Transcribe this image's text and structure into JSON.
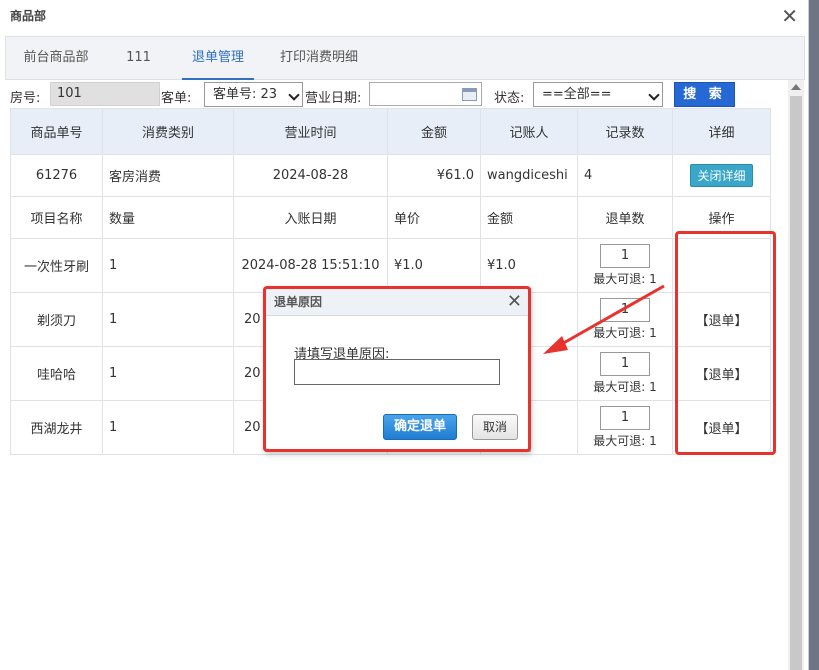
{
  "window": {
    "title": "商品部"
  },
  "tabs": [
    {
      "label": "前台商品部"
    },
    {
      "label": "111"
    },
    {
      "label": "退单管理"
    },
    {
      "label": "打印消费明细"
    }
  ],
  "filters": {
    "room_label": "房号:",
    "room_value": "101",
    "order_label": "客单:",
    "order_select": "客单号: 23",
    "date_label": "营业日期:",
    "date_value": "",
    "status_label": "状态:",
    "status_select": "==全部==",
    "search_label": "搜 索"
  },
  "table": {
    "headers": [
      "商品单号",
      "消费类别",
      "营业时间",
      "金额",
      "记账人",
      "记录数",
      "详细"
    ],
    "order_row": {
      "id": "61276",
      "category": "客房消费",
      "business_time": "2024-08-28",
      "amount": "¥61.0",
      "bookkeeper": "wangdiceshi",
      "records": "4",
      "detail_btn": "关闭详细"
    },
    "sub_headers": [
      "项目名称",
      "数量",
      "入账日期",
      "单价",
      "金额",
      "退单数",
      "操作"
    ],
    "items": [
      {
        "name": "一次性牙刷",
        "qty": "1",
        "date": "2024-08-28 15:51:10",
        "price": "¥1.0",
        "amount": "¥1.0",
        "refund_qty": "1",
        "max_refund": "最大可退: 1",
        "action": ""
      },
      {
        "name": "剃须刀",
        "qty": "1",
        "date": "20",
        "price": "",
        "amount": "",
        "refund_qty": "1",
        "max_refund": "最大可退: 1",
        "action": "【退单】"
      },
      {
        "name": "哇哈哈",
        "qty": "1",
        "date": "20",
        "price": "",
        "amount": "",
        "refund_qty": "1",
        "max_refund": "最大可退: 1",
        "action": "【退单】"
      },
      {
        "name": "西湖龙井",
        "qty": "1",
        "date": "20",
        "price": "",
        "amount": "",
        "refund_qty": "1",
        "max_refund": "最大可退: 1",
        "action": "【退单】"
      }
    ]
  },
  "dialog": {
    "title": "退单原因",
    "prompt": "请填写退单原因:",
    "reason_value": "",
    "confirm_label": "确定退单",
    "cancel_label": "取消"
  },
  "colors": {
    "accent": "#2f6fc4",
    "search_button": "#2769d4",
    "annotation_red": "#e8322d",
    "header_bg": "#e7eef8"
  }
}
